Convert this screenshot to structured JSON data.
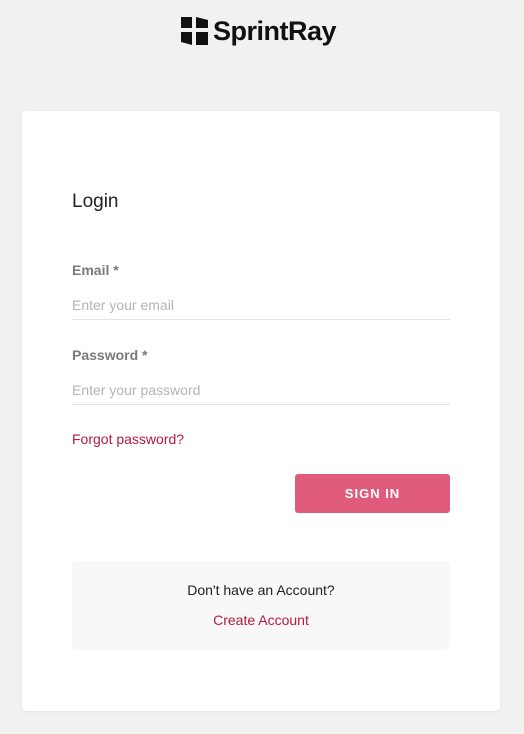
{
  "brand": {
    "name": "SprintRay",
    "logo_icon": "sprintray-logo-icon"
  },
  "login": {
    "title": "Login",
    "email": {
      "label": "Email *",
      "value": "",
      "placeholder": "Enter your email"
    },
    "password": {
      "label": "Password *",
      "value": "",
      "placeholder": "Enter your password"
    },
    "forgot_label": "Forgot password?",
    "signin_label": "SIGN IN"
  },
  "signup": {
    "prompt": "Don't have an Account?",
    "link_label": "Create Account"
  },
  "colors": {
    "background": "#f1f1f1",
    "accent": "#e05b7c",
    "link": "#b51a3f"
  }
}
